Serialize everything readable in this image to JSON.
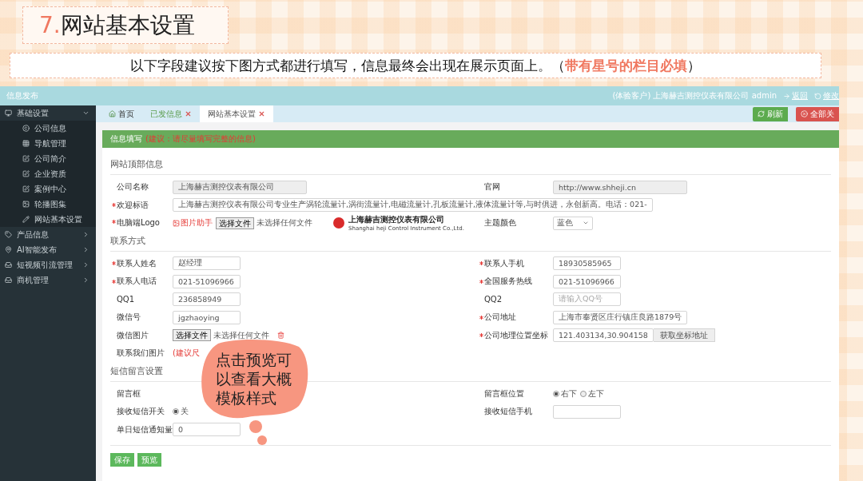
{
  "slide": {
    "number": "7.",
    "title": "网站基本设置",
    "subtitle": {
      "text": "以下字段建议按下图方式都进行填写，信息最终会出现在展示页面上。（",
      "highlight": "带有星号的栏目必填",
      "end": "）"
    }
  },
  "topbar": {
    "title": "信息发布",
    "account": "(体验客户) 上海赫吉测控仪表有限公司 admin",
    "links": [
      "返回",
      "修改"
    ]
  },
  "sidebar": [
    {
      "label": "基础设置",
      "expanded": true,
      "children": [
        {
          "label": "公司信息"
        },
        {
          "label": "导航管理"
        },
        {
          "label": "公司简介"
        },
        {
          "label": "企业资质"
        },
        {
          "label": "案例中心"
        },
        {
          "label": "轮播图集"
        },
        {
          "label": "网站基本设置"
        }
      ]
    },
    {
      "label": "产品信息",
      "expanded": false
    },
    {
      "label": "AI智能发布",
      "expanded": false
    },
    {
      "label": "短视频引流管理",
      "expanded": false
    },
    {
      "label": "商机管理",
      "expanded": false
    }
  ],
  "tabs": [
    {
      "label": "首页",
      "selected": false,
      "closable": false
    },
    {
      "label": "已发信息",
      "selected": false,
      "closable": true
    },
    {
      "label": "网站基本设置",
      "selected": true,
      "closable": true
    }
  ],
  "tab_actions": [
    {
      "label": "刷新",
      "kind": "refresh"
    },
    {
      "label": "全部关",
      "kind": "close_all"
    }
  ],
  "panel": {
    "title": "信息填写",
    "hint": "(建议：请尽量填写完整的信息)"
  },
  "sections": [
    {
      "title": "网站顶部信息",
      "rows": [
        {
          "left": {
            "label": "公司名称",
            "required": false,
            "kind": "readonly",
            "value": "上海赫吉测控仪表有限公司"
          },
          "right": {
            "label": "官网",
            "required": false,
            "kind": "readonly",
            "value": "http://www.shheji.cn"
          }
        },
        {
          "left": {
            "label": "欢迎标语",
            "required": true,
            "kind": "text",
            "value": "上海赫吉测控仪表有限公司专业生产涡轮流量计,涡街流量计,电磁流量计,孔板流量计,液体流量计等,与时俱进，永创新高。电话：021-"
          }
        },
        {
          "left": {
            "label": "电脑端Logo",
            "required": true,
            "kind": "file",
            "tag": "图片助手",
            "button": "选择文件",
            "status": "未选择任何文件",
            "logo": {
              "name": "上海赫吉测控仪表有限公司",
              "subtitle": "Shanghai heji Control Instrument Co.,Ltd."
            }
          },
          "right": {
            "label": "主题颜色",
            "required": false,
            "kind": "select",
            "value": "蓝色"
          }
        }
      ]
    },
    {
      "title": "联系方式",
      "rows": [
        {
          "left": {
            "label": "联系人姓名",
            "required": true,
            "kind": "text",
            "value": "赵经理"
          },
          "right": {
            "label": "联系人手机",
            "required": true,
            "kind": "text",
            "value": "18930585965"
          }
        },
        {
          "left": {
            "label": "联系人电话",
            "required": true,
            "kind": "text",
            "value": "021-51096966"
          },
          "right": {
            "label": "全国服务热线",
            "required": true,
            "kind": "text",
            "value": "021-51096966"
          }
        },
        {
          "left": {
            "label": "QQ1",
            "required": false,
            "kind": "text",
            "value": "236858949"
          },
          "right": {
            "label": "QQ2",
            "required": false,
            "kind": "text",
            "placeholder": "请输入QQ号"
          }
        },
        {
          "left": {
            "label": "微信号",
            "required": false,
            "kind": "text",
            "value": "jgzhaoying"
          },
          "right": {
            "label": "公司地址",
            "required": true,
            "kind": "text",
            "value": "上海市奉贤区庄行镇庄良路1879号"
          }
        },
        {
          "left": {
            "label": "微信图片",
            "required": false,
            "kind": "file",
            "button": "选择文件",
            "status": "未选择任何文件",
            "removable": true
          },
          "right": {
            "label": "公司地理位置坐标",
            "required": true,
            "kind": "coord",
            "value": "121.403134,30.904158",
            "button": "获取坐标地址"
          }
        },
        {
          "left": {
            "label": "联系我们图片",
            "required": false,
            "kind": "note",
            "note": "(建议尺"
          }
        }
      ]
    },
    {
      "title": "短信留言设置",
      "rows": [
        {
          "left": {
            "label": "留言框",
            "required": false,
            "kind": "none"
          },
          "right": {
            "label": "留言框位置",
            "required": false,
            "kind": "radio",
            "options": [
              {
                "label": "右下",
                "selected": true
              },
              {
                "label": "左下",
                "selected": false
              }
            ]
          }
        },
        {
          "left": {
            "label": "接收短信开关",
            "required": false,
            "kind": "radio",
            "options": [
              {
                "label": "关",
                "selected": true
              }
            ]
          },
          "right": {
            "label": "接收短信手机",
            "required": false,
            "kind": "text"
          }
        },
        {
          "left": {
            "label": "单日短信通知量",
            "required": false,
            "kind": "text",
            "value": "0"
          }
        }
      ]
    }
  ],
  "buttons": [
    "保存",
    "预览"
  ],
  "callout": "点击预览可以查看大概模板样式"
}
